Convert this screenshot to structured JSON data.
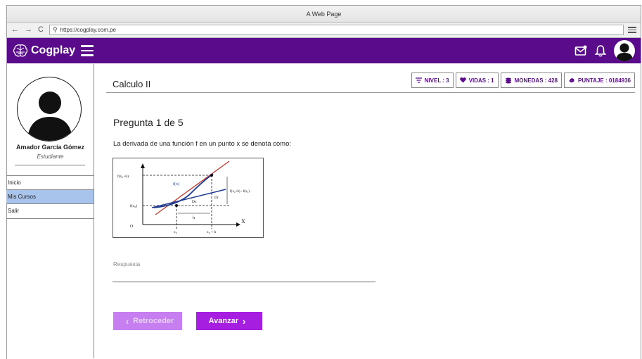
{
  "browser": {
    "title": "A Web Page",
    "url": "https://cogplay.com.pe"
  },
  "app": {
    "name": "Cogplay",
    "brand_color": "#5a0b8c",
    "icons": [
      "brain-logo-icon",
      "hamburger-menu-icon",
      "mail-icon",
      "bell-icon",
      "user-avatar-icon"
    ]
  },
  "profile": {
    "name": "Amador García Gómez",
    "role": "Estudiante"
  },
  "sidebar": {
    "items": [
      {
        "label": "Inicio",
        "active": false
      },
      {
        "label": "Mis Cursos",
        "active": true
      },
      {
        "label": "Salir",
        "active": false
      }
    ],
    "active_color": "#a8c4ec"
  },
  "course": {
    "title": "Calculo II"
  },
  "stats": {
    "nivel": "NIVEL : 3",
    "vidas": "VIDAS : 1",
    "monedas": "MONEDAS : 428",
    "puntaje": "PUNTAJE : 0184936"
  },
  "question": {
    "number": "Pregunta 1 de 5",
    "text": "La derivada de una función f en un punto x se denota como:"
  },
  "figure": {
    "labels": {
      "f_x0_h": "f(x₀+h)",
      "f_x0": "f(x₀)",
      "fx": "f(x)",
      "diff": "f(x₀+h) - f(x₀)",
      "dx": "Dx",
      "dr": "Dr.",
      "h": "h",
      "X": "X",
      "O": "O",
      "x0": "x₀",
      "x0h": "x₀ + h"
    }
  },
  "answer": {
    "label": "Respuesta",
    "value": ""
  },
  "buttons": {
    "prev": "Retroceder",
    "next": "Avanzar",
    "prev_color": "#c77ef0",
    "next_color": "#a61ee0"
  }
}
